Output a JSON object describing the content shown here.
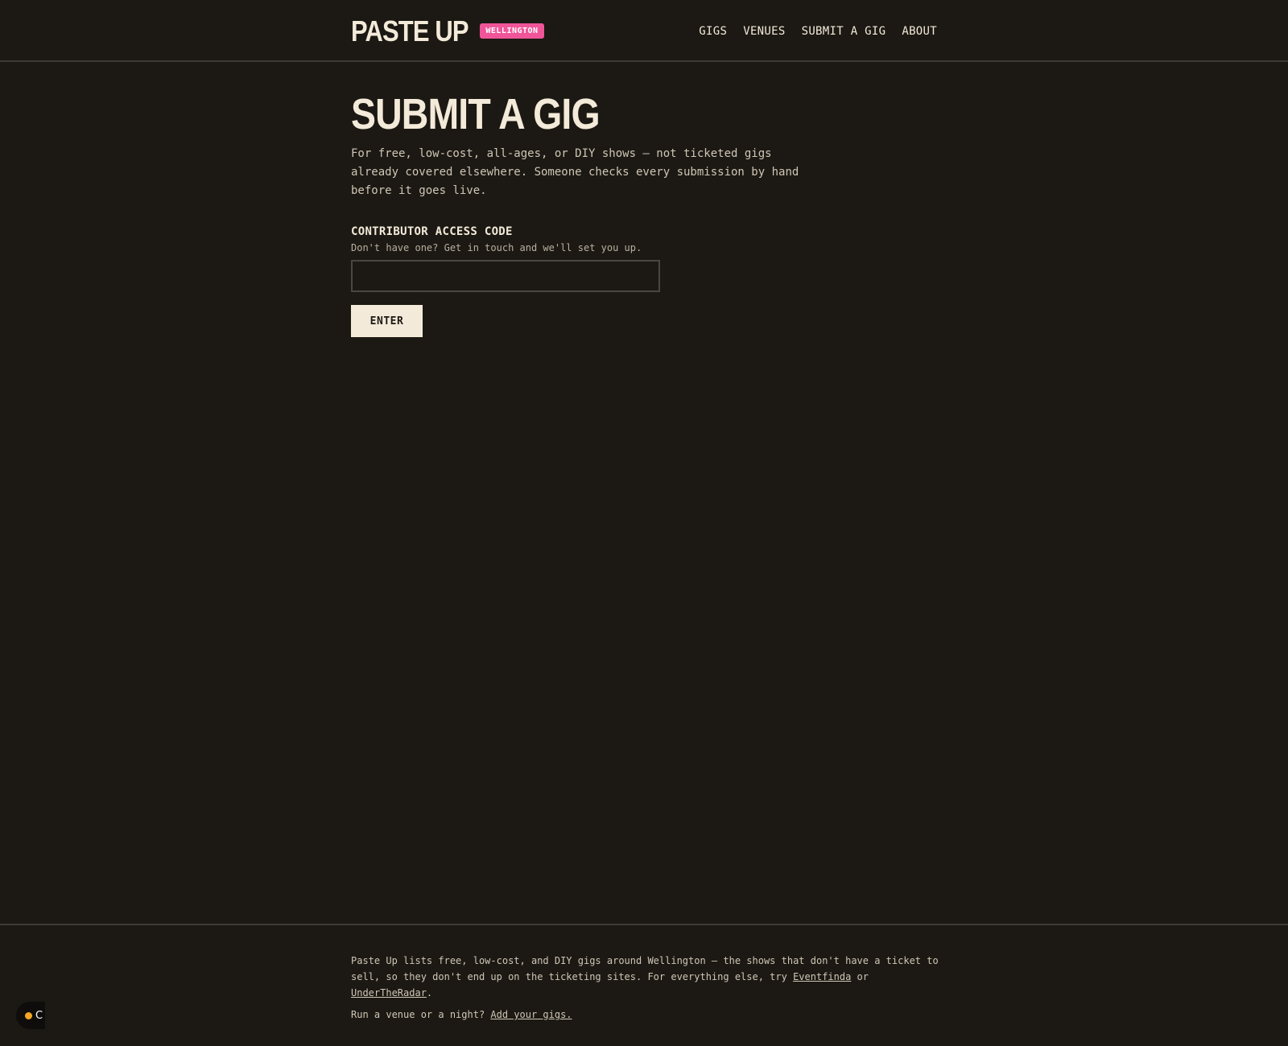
{
  "header": {
    "logo": "PASTE UP",
    "badge": "WELLINGTON",
    "nav": [
      "GIGS",
      "VENUES",
      "SUBMIT A GIG",
      "ABOUT"
    ]
  },
  "main": {
    "title": "SUBMIT A GIG",
    "intro": "For free, low-cost, all-ages, or DIY shows — not ticketed gigs already covered elsewhere. Someone checks every submission by hand before it goes live.",
    "field_label": "CONTRIBUTOR ACCESS CODE",
    "field_help": "Don't have one? Get in touch and we'll set you up.",
    "input_value": "",
    "button": "ENTER"
  },
  "footer": {
    "text_before": "Paste Up lists free, low-cost, and DIY gigs around Wellington — the shows that don't have a ticket to sell, so they don't end up on the ticketing sites. For everything else, try ",
    "link1": "Eventfinda",
    "text_mid": " or ",
    "link2": "UnderTheRadar",
    "text_after": ".",
    "line2_text": "Run a venue or a night? ",
    "line2_link": "Add your gigs."
  },
  "widget": {
    "text": "C",
    "dot_color": "#f5a623"
  },
  "colors": {
    "background": "#1c1914",
    "text": "#f3ead9",
    "badge": "#f05599"
  }
}
